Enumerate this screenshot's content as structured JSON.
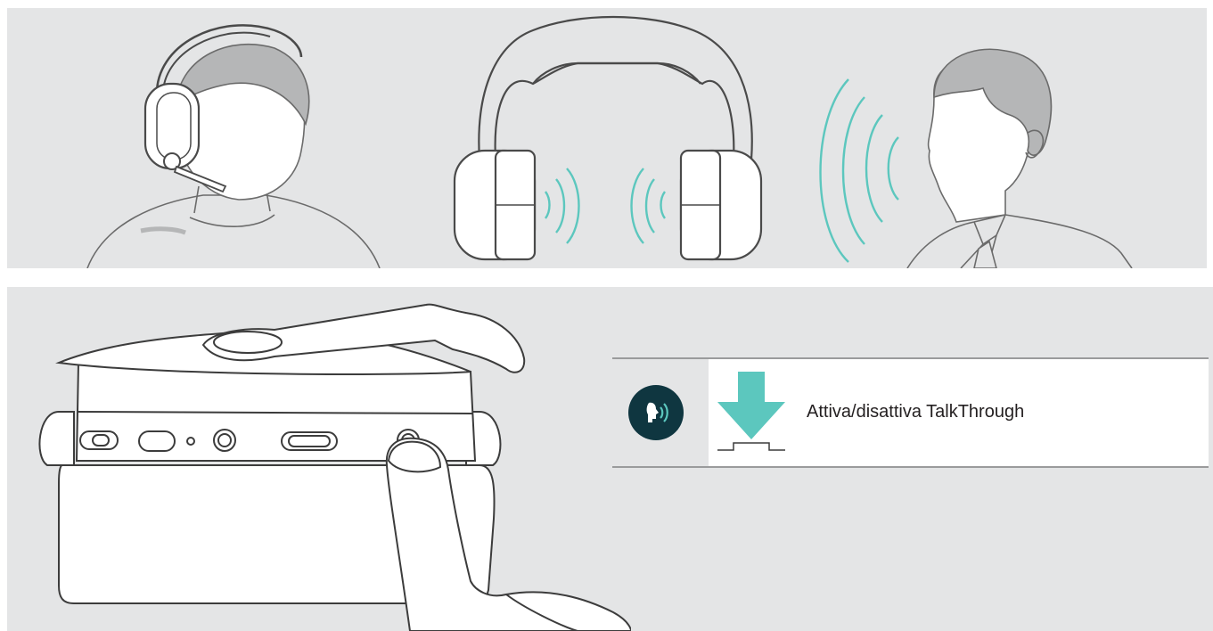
{
  "instruction": {
    "action_label": "Attiva/disattiva TalkThrough",
    "badge_icon": "talkthrough-icon",
    "press_icon": "button-press-arrow-icon"
  },
  "colors": {
    "panel_background": "#e4e5e6",
    "badge_background": "#0f3640",
    "accent_teal": "#5cc7be",
    "line_art": "#4a4a4a",
    "head_shadow": "#b5b6b7"
  },
  "illustrations": {
    "top_panel": [
      "user-wearing-headset-illustration",
      "headset-talkthrough-illustration",
      "speaking-person-illustration"
    ],
    "bottom_panel": "headset-button-press-illustration"
  }
}
